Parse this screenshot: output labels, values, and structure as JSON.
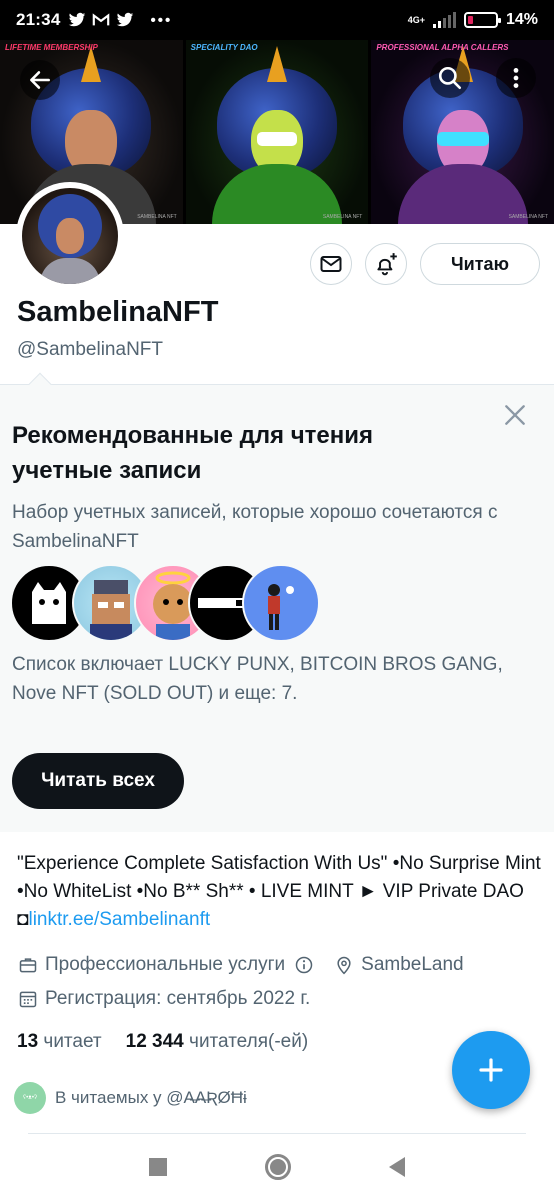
{
  "status_bar": {
    "time": "21:34",
    "network": "4G+",
    "battery_percent": "14%",
    "icons": [
      "twitter-icon",
      "gmail-icon",
      "twitter-icon",
      "more-dots-icon"
    ]
  },
  "banner": {
    "panels": [
      {
        "label": "LIFETIME MEMBERSHIP",
        "watermark": "SAMBELINA NFT"
      },
      {
        "label": "SPECIALITY DAO",
        "watermark": "SAMBELINA NFT"
      },
      {
        "label": "PROFESSIONAL ALPHA CALLERS",
        "watermark": "SAMBELINA NFT"
      }
    ]
  },
  "profile": {
    "name": "SambelinaNFT",
    "handle": "@SambelinaNFT",
    "follow_label": "Читаю"
  },
  "recommended": {
    "title": "Рекомендованные для чтения учетные записи",
    "description": "Набор учетных записей, которые хорошо сочетаются с SambelinaNFT",
    "list_text": "Список включает LUCKY PUNX, BITCOIN BROS GANG, Nove NFT (SOLD OUT) и еще: 7.",
    "follow_all_label": "Читать всех"
  },
  "bio": {
    "text": "\"Experience Complete Satisfaction With Us\"  •No Surprise Mint   •No WhiteList  •No B** Sh**  • LIVE MINT ► VIP Private DAO  ◘",
    "link": "linktr.ee/Sambelinanft"
  },
  "meta": {
    "category": "Профессиональные услуги",
    "location": "SambeLand",
    "joined": "Регистрация: сентябрь 2022 г."
  },
  "counts": {
    "following_num": "13",
    "following_label": "читает",
    "followers_num": "12 344",
    "followers_label": "читателя(-ей)"
  },
  "followed_by": {
    "text": "В читаемых у @A̶A̶ƦØĦɨ",
    "avatar_text": "ʕ•ᴥ•ʔ"
  },
  "colors": {
    "accent": "#1d9bf0",
    "text_primary": "#0f1419",
    "text_secondary": "#536471",
    "rec_background": "#f7f9f9"
  }
}
